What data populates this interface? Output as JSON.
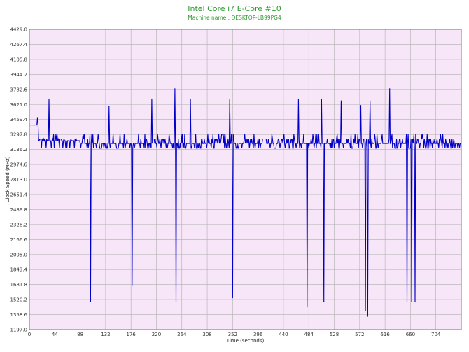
{
  "title": "Intel Core i7 E-Core #10",
  "subtitle": "Machine name : DESKTOP-LB99PG4",
  "colors": {
    "plot_background": "#f7e6f7",
    "grid": "#b0b0b0",
    "line": "#0000c8",
    "title": "#2e9a2e"
  },
  "chart_data": {
    "type": "line",
    "title": "Intel Core i7 E-Core #10",
    "subtitle": "Machine name : DESKTOP-LB99PG4",
    "xlabel": "Time (seconds)",
    "ylabel": "Clock Speed (MHz)",
    "xlim": [
      0,
      748
    ],
    "ylim": [
      1197.0,
      4429.0
    ],
    "x_ticks": [
      0,
      44,
      88,
      132,
      176,
      220,
      264,
      308,
      352,
      396,
      440,
      484,
      528,
      572,
      616,
      660,
      704
    ],
    "y_ticks": [
      1197.0,
      1358.6,
      1520.2,
      1681.8,
      1843.4,
      2005.0,
      2166.6,
      2328.2,
      2489.8,
      2651.4,
      2813.0,
      2974.6,
      3136.2,
      3297.8,
      3459.4,
      3621.0,
      3782.6,
      3944.2,
      4105.8,
      4267.4,
      4429.0
    ],
    "grid": true,
    "legend": "none",
    "baseline": {
      "segments": [
        {
          "x": [
            0,
            16
          ],
          "y": 3400
        },
        {
          "x": [
            16,
            88
          ],
          "y": 3230
        },
        {
          "x": [
            88,
            748
          ],
          "y": 3200
        }
      ],
      "noise_levels": [
        3150,
        3200,
        3250,
        3300
      ]
    },
    "spikes": [
      {
        "x": 14,
        "y": 3480
      },
      {
        "x": 34,
        "y": 3680
      },
      {
        "x": 106,
        "y": 1500
      },
      {
        "x": 138,
        "y": 3600
      },
      {
        "x": 178,
        "y": 1680
      },
      {
        "x": 212,
        "y": 3680
      },
      {
        "x": 252,
        "y": 3790
      },
      {
        "x": 254,
        "y": 1500
      },
      {
        "x": 279,
        "y": 3680
      },
      {
        "x": 347,
        "y": 3680
      },
      {
        "x": 352,
        "y": 1540
      },
      {
        "x": 466,
        "y": 3680
      },
      {
        "x": 481,
        "y": 1440
      },
      {
        "x": 506,
        "y": 3680
      },
      {
        "x": 510,
        "y": 1500
      },
      {
        "x": 540,
        "y": 3660
      },
      {
        "x": 574,
        "y": 3610
      },
      {
        "x": 582,
        "y": 1400
      },
      {
        "x": 586,
        "y": 1340
      },
      {
        "x": 590,
        "y": 3660
      },
      {
        "x": 624,
        "y": 3790
      },
      {
        "x": 654,
        "y": 1500
      },
      {
        "x": 662,
        "y": 1500
      },
      {
        "x": 668,
        "y": 1500
      }
    ]
  }
}
